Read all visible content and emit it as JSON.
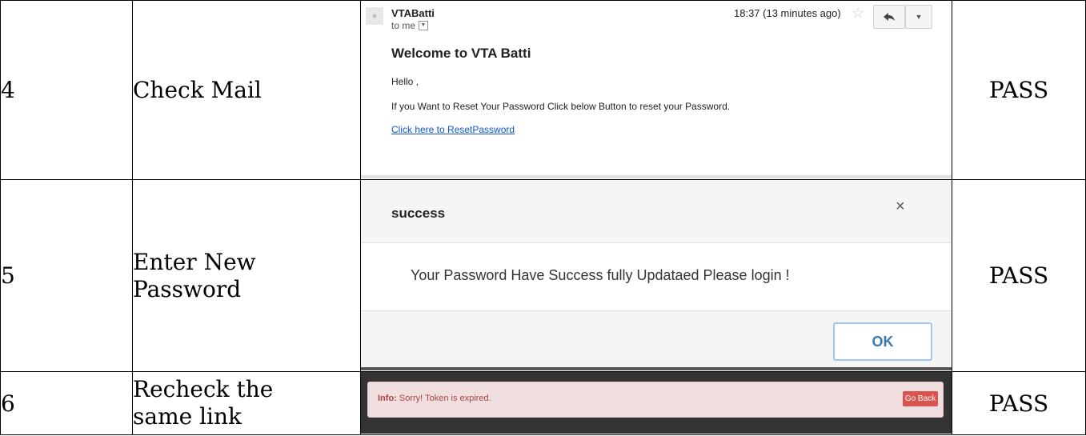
{
  "rows": [
    {
      "num": "4",
      "step": "Check Mail",
      "result": "PASS",
      "email": {
        "sender": "VTABatti",
        "recipient": "to me",
        "time": "18:37 (13 minutes ago)",
        "heading": "Welcome to VTA Batti",
        "greeting": "Hello ,",
        "body": "If you Want to Reset Your Password Click below Button to reset your Password.",
        "link": "Click here to ResetPassword"
      }
    },
    {
      "num": "5",
      "step_line1": "Enter New",
      "step_line2": "Password",
      "result": "PASS",
      "modal": {
        "title": "success",
        "close": "×",
        "message": "Your Password Have Success fully Updataed Please login !",
        "ok": "OK"
      }
    },
    {
      "num": "6",
      "step_line1": "Recheck the",
      "step_line2": "same link",
      "result": "PASS",
      "info": {
        "label": "Info:",
        "message": "Sorry! Token is expired.",
        "button": "Go Back"
      }
    }
  ],
  "icons": {
    "avatar": "person-icon",
    "star": "☆",
    "reply": "reply-icon",
    "more": "▼"
  },
  "colors": {
    "link": "#1155cc",
    "ok_border": "#9ec8ef",
    "ok_text": "#3c78b4",
    "info_bg": "#f1dede",
    "info_text": "#a94442",
    "goback_bg": "#d9534f"
  }
}
